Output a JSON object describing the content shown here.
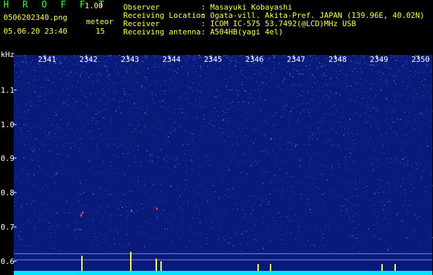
{
  "app": {
    "title": "H R O F F T",
    "version": "1.00",
    "filename": "0506202340.png",
    "datetime": "05.06.20 23:40",
    "meteor_label": "meteor",
    "meteor_count": "15"
  },
  "info": {
    "labels": [
      "Observer",
      "Receiving Location",
      "Receiver",
      "Receiving antenna"
    ],
    "values": [
      ": Masayuki Kobayashi",
      ": Ogata-vill. Akita-Pref. JAPAN (139.96E, 40.02N)",
      ": ICOM IC-575 53.7492(@LCD)MHz USB",
      ": A504HB(yagi 4el)"
    ]
  },
  "axes": {
    "y_unit": "kHz",
    "y_ticks": [
      "1.1",
      "1.0",
      "0.9",
      "0.8",
      "0.7",
      "0.6"
    ],
    "x_ticks": [
      "2341",
      "2342",
      "2343",
      "2344",
      "2345",
      "2346",
      "2347",
      "2348",
      "2349",
      "2350"
    ]
  },
  "colors": {
    "title": "#3cff3c",
    "header_text": "#ffff55",
    "background": "#000000",
    "spectrum": "#0a1a7a",
    "baseline": "#00e5ff"
  }
}
